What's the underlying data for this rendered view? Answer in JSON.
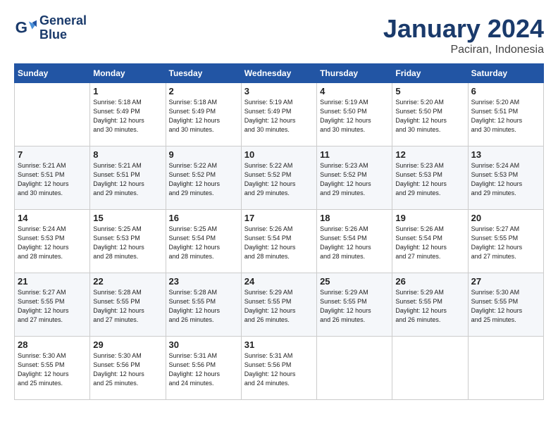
{
  "header": {
    "logo_line1": "General",
    "logo_line2": "Blue",
    "month_year": "January 2024",
    "location": "Paciran, Indonesia"
  },
  "weekdays": [
    "Sunday",
    "Monday",
    "Tuesday",
    "Wednesday",
    "Thursday",
    "Friday",
    "Saturday"
  ],
  "weeks": [
    [
      {
        "day": "",
        "info": ""
      },
      {
        "day": "1",
        "info": "Sunrise: 5:18 AM\nSunset: 5:49 PM\nDaylight: 12 hours\nand 30 minutes."
      },
      {
        "day": "2",
        "info": "Sunrise: 5:18 AM\nSunset: 5:49 PM\nDaylight: 12 hours\nand 30 minutes."
      },
      {
        "day": "3",
        "info": "Sunrise: 5:19 AM\nSunset: 5:49 PM\nDaylight: 12 hours\nand 30 minutes."
      },
      {
        "day": "4",
        "info": "Sunrise: 5:19 AM\nSunset: 5:50 PM\nDaylight: 12 hours\nand 30 minutes."
      },
      {
        "day": "5",
        "info": "Sunrise: 5:20 AM\nSunset: 5:50 PM\nDaylight: 12 hours\nand 30 minutes."
      },
      {
        "day": "6",
        "info": "Sunrise: 5:20 AM\nSunset: 5:51 PM\nDaylight: 12 hours\nand 30 minutes."
      }
    ],
    [
      {
        "day": "7",
        "info": "Sunrise: 5:21 AM\nSunset: 5:51 PM\nDaylight: 12 hours\nand 30 minutes."
      },
      {
        "day": "8",
        "info": "Sunrise: 5:21 AM\nSunset: 5:51 PM\nDaylight: 12 hours\nand 29 minutes."
      },
      {
        "day": "9",
        "info": "Sunrise: 5:22 AM\nSunset: 5:52 PM\nDaylight: 12 hours\nand 29 minutes."
      },
      {
        "day": "10",
        "info": "Sunrise: 5:22 AM\nSunset: 5:52 PM\nDaylight: 12 hours\nand 29 minutes."
      },
      {
        "day": "11",
        "info": "Sunrise: 5:23 AM\nSunset: 5:52 PM\nDaylight: 12 hours\nand 29 minutes."
      },
      {
        "day": "12",
        "info": "Sunrise: 5:23 AM\nSunset: 5:53 PM\nDaylight: 12 hours\nand 29 minutes."
      },
      {
        "day": "13",
        "info": "Sunrise: 5:24 AM\nSunset: 5:53 PM\nDaylight: 12 hours\nand 29 minutes."
      }
    ],
    [
      {
        "day": "14",
        "info": "Sunrise: 5:24 AM\nSunset: 5:53 PM\nDaylight: 12 hours\nand 28 minutes."
      },
      {
        "day": "15",
        "info": "Sunrise: 5:25 AM\nSunset: 5:53 PM\nDaylight: 12 hours\nand 28 minutes."
      },
      {
        "day": "16",
        "info": "Sunrise: 5:25 AM\nSunset: 5:54 PM\nDaylight: 12 hours\nand 28 minutes."
      },
      {
        "day": "17",
        "info": "Sunrise: 5:26 AM\nSunset: 5:54 PM\nDaylight: 12 hours\nand 28 minutes."
      },
      {
        "day": "18",
        "info": "Sunrise: 5:26 AM\nSunset: 5:54 PM\nDaylight: 12 hours\nand 28 minutes."
      },
      {
        "day": "19",
        "info": "Sunrise: 5:26 AM\nSunset: 5:54 PM\nDaylight: 12 hours\nand 27 minutes."
      },
      {
        "day": "20",
        "info": "Sunrise: 5:27 AM\nSunset: 5:55 PM\nDaylight: 12 hours\nand 27 minutes."
      }
    ],
    [
      {
        "day": "21",
        "info": "Sunrise: 5:27 AM\nSunset: 5:55 PM\nDaylight: 12 hours\nand 27 minutes."
      },
      {
        "day": "22",
        "info": "Sunrise: 5:28 AM\nSunset: 5:55 PM\nDaylight: 12 hours\nand 27 minutes."
      },
      {
        "day": "23",
        "info": "Sunrise: 5:28 AM\nSunset: 5:55 PM\nDaylight: 12 hours\nand 26 minutes."
      },
      {
        "day": "24",
        "info": "Sunrise: 5:29 AM\nSunset: 5:55 PM\nDaylight: 12 hours\nand 26 minutes."
      },
      {
        "day": "25",
        "info": "Sunrise: 5:29 AM\nSunset: 5:55 PM\nDaylight: 12 hours\nand 26 minutes."
      },
      {
        "day": "26",
        "info": "Sunrise: 5:29 AM\nSunset: 5:55 PM\nDaylight: 12 hours\nand 26 minutes."
      },
      {
        "day": "27",
        "info": "Sunrise: 5:30 AM\nSunset: 5:55 PM\nDaylight: 12 hours\nand 25 minutes."
      }
    ],
    [
      {
        "day": "28",
        "info": "Sunrise: 5:30 AM\nSunset: 5:55 PM\nDaylight: 12 hours\nand 25 minutes."
      },
      {
        "day": "29",
        "info": "Sunrise: 5:30 AM\nSunset: 5:56 PM\nDaylight: 12 hours\nand 25 minutes."
      },
      {
        "day": "30",
        "info": "Sunrise: 5:31 AM\nSunset: 5:56 PM\nDaylight: 12 hours\nand 24 minutes."
      },
      {
        "day": "31",
        "info": "Sunrise: 5:31 AM\nSunset: 5:56 PM\nDaylight: 12 hours\nand 24 minutes."
      },
      {
        "day": "",
        "info": ""
      },
      {
        "day": "",
        "info": ""
      },
      {
        "day": "",
        "info": ""
      }
    ]
  ]
}
